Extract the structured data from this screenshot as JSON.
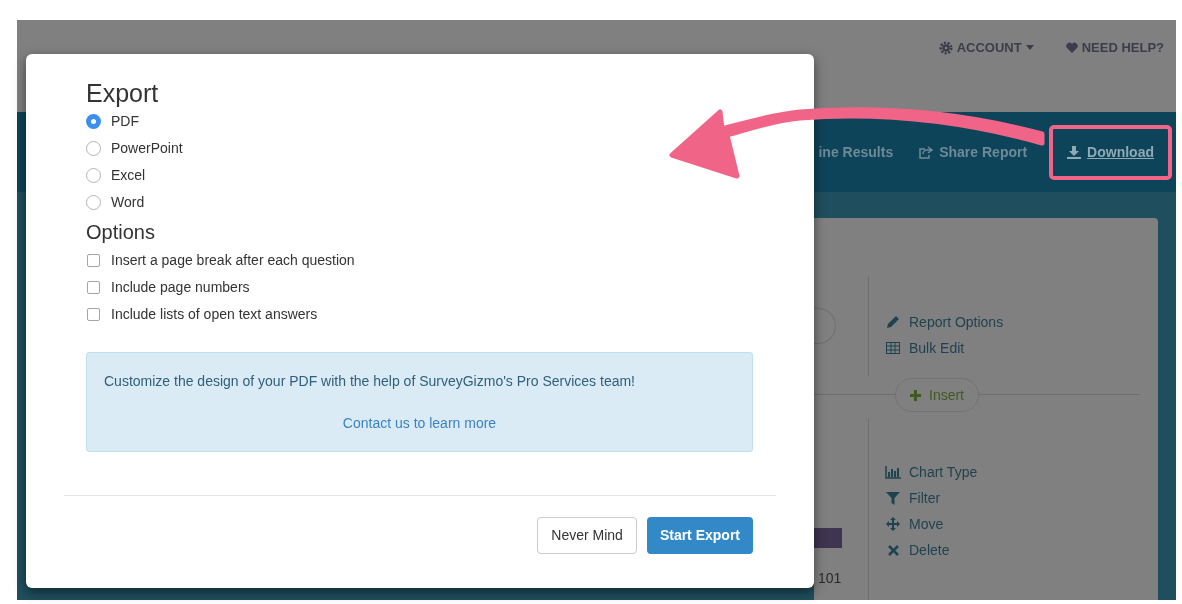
{
  "top_nav": {
    "account": "ACCOUNT",
    "help": "NEED HELP?"
  },
  "toolbar": {
    "items": [
      {
        "label": "ine Results",
        "kind": "plain"
      },
      {
        "label": "Share Report",
        "kind": "share"
      },
      {
        "label": "Download",
        "kind": "download",
        "highlighted": true
      }
    ]
  },
  "side_panel": {
    "top_actions": [
      {
        "label": "Report Options",
        "kind": "pencil"
      },
      {
        "label": "Bulk Edit",
        "kind": "table"
      }
    ],
    "insert_button": "Insert",
    "chart_actions": [
      {
        "label": "Chart Type",
        "kind": "chart"
      },
      {
        "label": "Filter",
        "kind": "filter"
      },
      {
        "label": "Move",
        "kind": "move"
      },
      {
        "label": "Delete",
        "kind": "delete"
      }
    ],
    "count": "101"
  },
  "modal": {
    "title": "Export",
    "formats": [
      {
        "label": "PDF",
        "selected": true
      },
      {
        "label": "PowerPoint",
        "selected": false
      },
      {
        "label": "Excel",
        "selected": false
      },
      {
        "label": "Word",
        "selected": false
      }
    ],
    "options_title": "Options",
    "options": [
      {
        "label": "Insert a page break after each question",
        "checked": false
      },
      {
        "label": "Include page numbers",
        "checked": false
      },
      {
        "label": "Include lists of open text answers",
        "checked": false
      }
    ],
    "info": {
      "text": "Customize the design of your PDF with the help of SurveyGizmo's Pro Services team!",
      "link": "Contact us to learn more"
    },
    "buttons": [
      {
        "label": "Never Mind",
        "kind": "secondary"
      },
      {
        "label": "Start Export",
        "kind": "primary"
      }
    ]
  }
}
